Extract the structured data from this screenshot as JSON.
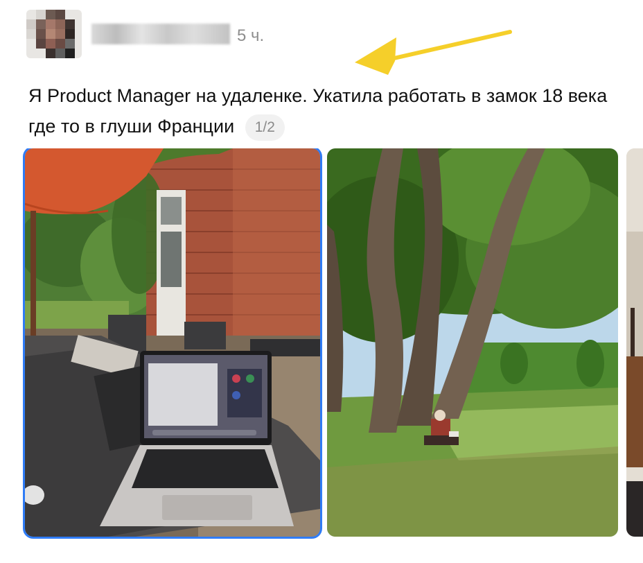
{
  "post": {
    "timestamp": "5 ч.",
    "text": "Я Product Manager на удаленке. Укатила работать в замок 18 века где то в глуши Франции",
    "image_counter": "1/2"
  },
  "colors": {
    "selection_outline": "#2f7cf6",
    "annotation_arrow": "#f5cf2a",
    "counter_bg": "#f1f1f1",
    "meta_text": "#8e8e8e"
  },
  "icons": {
    "annotation": "arrow-left-icon"
  },
  "images": [
    {
      "name": "photo-laptop-on-terrace"
    },
    {
      "name": "photo-castle-garden-trees"
    },
    {
      "name": "photo-next-partial"
    }
  ]
}
